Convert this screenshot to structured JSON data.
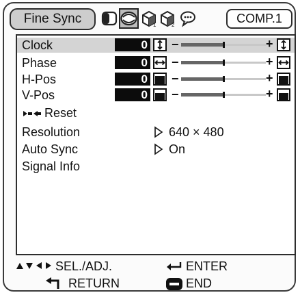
{
  "tabs": {
    "active_label": "Fine Sync",
    "icons": [
      "picture-icon",
      "fine-sync-icon",
      "options1-icon",
      "options2-icon",
      "language-icon"
    ],
    "input_label": "COMP.1"
  },
  "menu": {
    "adjust_rows": [
      {
        "label": "Clock",
        "value": "0",
        "icon": "clock-width-icon",
        "level": 0.5
      },
      {
        "label": "Phase",
        "value": "0",
        "icon": "phase-icon",
        "level": 0.5
      },
      {
        "label": "H-Pos",
        "value": "0",
        "icon": "h-position-icon",
        "level": 0.5
      },
      {
        "label": "V-Pos",
        "value": "0",
        "icon": "v-position-icon",
        "level": 0.5
      }
    ],
    "slider_minus": "−",
    "slider_plus": "+",
    "reset_label": "Reset",
    "info_rows": [
      {
        "label": "Resolution",
        "value": "640 × 480"
      },
      {
        "label": "Auto Sync",
        "value": "On"
      },
      {
        "label": "Signal Info",
        "value": ""
      }
    ]
  },
  "footer": {
    "sel_adj": "SEL./ADJ.",
    "enter": "ENTER",
    "return": "RETURN",
    "end": "END"
  },
  "colors": {
    "selected_row": "#d4d4d4",
    "value_box": "#0c0c0c",
    "tab_active": "#cdcdcd"
  }
}
